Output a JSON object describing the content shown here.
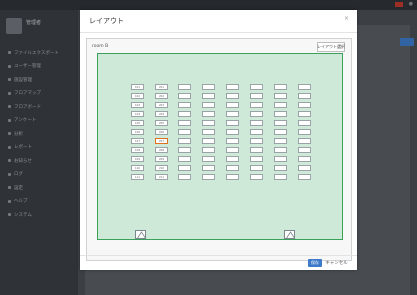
{
  "topbar": {
    "app_title": ""
  },
  "user": {
    "name": "管理者",
    "subtitle": ""
  },
  "sidebar": {
    "items": [
      {
        "label": "ファイルエクスポート"
      },
      {
        "label": "ユーザー管理"
      },
      {
        "label": "施設管理"
      },
      {
        "label": "フロアマップ"
      },
      {
        "label": "フロアボード"
      },
      {
        "label": "アンケート"
      },
      {
        "label": "分析"
      },
      {
        "label": "レポート"
      },
      {
        "label": "お知らせ"
      },
      {
        "label": "ログ"
      },
      {
        "label": "設定"
      },
      {
        "label": "ヘルプ"
      },
      {
        "label": "システム"
      }
    ]
  },
  "modal": {
    "title": "レイアウト",
    "close_label": "×",
    "room_name": "room B",
    "select_label": "レイアウト選択",
    "save_label": "保存",
    "cancel_label": "キャンセル"
  },
  "desk_labels": {
    "col1": [
      "101",
      "102",
      "103",
      "104",
      "105",
      "106",
      "107",
      "108",
      "109",
      "110",
      "111"
    ],
    "col2": [
      "201",
      "202",
      "203",
      "204",
      "205",
      "206",
      "207",
      "208",
      "209",
      "210",
      "211"
    ]
  },
  "selected_desk": "207",
  "colors": {
    "floor": "#cfe9d8",
    "floor_border": "#3aa05a",
    "accent": "#3d7ac9",
    "selected": "#e07020"
  }
}
